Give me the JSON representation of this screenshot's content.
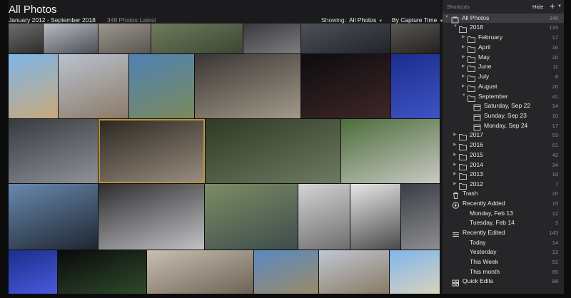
{
  "header": {
    "title": "All Photos",
    "date_range": "January 2012 - September 2018",
    "photo_count": "348 Photos Latest",
    "showing_label": "Showing:",
    "showing_value": "All Photos",
    "sort_value": "By Capture Time"
  },
  "sidebar": {
    "shortcuts_label": "Shortcuts",
    "hide_label": "Hide",
    "add_icon": "plus-icon",
    "rows": [
      {
        "name": "all-photos",
        "label": "All Photos",
        "count": "348",
        "icon": "photos-icon",
        "selected": true
      },
      {
        "name": "year-2018",
        "label": "2018",
        "count": "133",
        "icon": "folder-icon"
      },
      {
        "name": "month-february",
        "label": "February",
        "count": "17",
        "icon": "folder-icon"
      },
      {
        "name": "month-april",
        "label": "April",
        "count": "16",
        "icon": "folder-icon"
      },
      {
        "name": "month-may",
        "label": "May",
        "count": "20",
        "icon": "folder-icon"
      },
      {
        "name": "month-june",
        "label": "June",
        "count": "11",
        "icon": "folder-icon"
      },
      {
        "name": "month-july",
        "label": "July",
        "count": "8",
        "icon": "folder-icon"
      },
      {
        "name": "month-august",
        "label": "August",
        "count": "20",
        "icon": "folder-icon"
      },
      {
        "name": "month-september",
        "label": "September",
        "count": "41",
        "icon": "folder-icon"
      },
      {
        "name": "day-saturday-sep-22",
        "label": "Saturday, Sep 22",
        "count": "14",
        "icon": "day-icon"
      },
      {
        "name": "day-sunday-sep-23",
        "label": "Sunday, Sep 23",
        "count": "10",
        "icon": "day-icon"
      },
      {
        "name": "day-monday-sep-24",
        "label": "Monday, Sep 24",
        "count": "17",
        "icon": "day-icon"
      },
      {
        "name": "year-2017",
        "label": "2017",
        "count": "53",
        "icon": "folder-icon"
      },
      {
        "name": "year-2016",
        "label": "2016",
        "count": "61",
        "icon": "folder-icon"
      },
      {
        "name": "year-2015",
        "label": "2015",
        "count": "42",
        "icon": "folder-icon"
      },
      {
        "name": "year-2014",
        "label": "2014",
        "count": "34",
        "icon": "folder-icon"
      },
      {
        "name": "year-2013",
        "label": "2013",
        "count": "16",
        "icon": "folder-icon"
      },
      {
        "name": "year-2012",
        "label": "2012",
        "count": "7",
        "icon": "folder-icon"
      },
      {
        "name": "trash",
        "label": "Trash",
        "count": "20",
        "icon": "trash-icon"
      },
      {
        "name": "recently-added",
        "label": "Recently Added",
        "count": "15",
        "icon": "plus-circle-icon"
      },
      {
        "name": "added-monday-feb-13",
        "label": "Monday, Feb 13",
        "count": "12",
        "icon": ""
      },
      {
        "name": "added-tuesday-feb-14",
        "label": "Tuesday, Feb 14",
        "count": "3",
        "icon": ""
      },
      {
        "name": "recently-edited",
        "label": "Recently Edited",
        "count": "143",
        "icon": "sliders-icon"
      },
      {
        "name": "edited-today",
        "label": "Today",
        "count": "14",
        "icon": ""
      },
      {
        "name": "edited-yesterday",
        "label": "Yesterday",
        "count": "12",
        "icon": ""
      },
      {
        "name": "edited-this-week",
        "label": "This Week",
        "count": "52",
        "icon": ""
      },
      {
        "name": "edited-this-month",
        "label": "This month",
        "count": "65",
        "icon": ""
      },
      {
        "name": "quick-edits",
        "label": "Quick Edits",
        "count": "88",
        "icon": "grid-icon"
      }
    ]
  },
  "grid": {
    "photos": [
      {
        "name": "photo-street",
        "desc": "street-scene"
      },
      {
        "name": "photo-airport-window",
        "desc": "airport-window"
      },
      {
        "name": "photo-building",
        "desc": "building"
      },
      {
        "name": "photo-highway-interchange",
        "desc": "highway-interchange"
      },
      {
        "name": "photo-subway-interior",
        "desc": "subway-interior"
      },
      {
        "name": "photo-bridge",
        "desc": "bridge"
      },
      {
        "name": "photo-subway-car",
        "desc": "subway-car"
      },
      {
        "name": "photo-portrait-dark",
        "desc": "portrait"
      },
      {
        "name": "photo-truck",
        "desc": "truck"
      },
      {
        "name": "photo-temple-of-heaven",
        "desc": "temple-of-heaven"
      },
      {
        "name": "photo-woman-lake-view",
        "desc": "woman-lake-view"
      },
      {
        "name": "photo-train-interior",
        "desc": "train-interior"
      },
      {
        "name": "photo-car-night",
        "desc": "car-night"
      },
      {
        "name": "photo-blue-curtain",
        "desc": "blue-curtain"
      },
      {
        "name": "photo-airport-terminal",
        "desc": "airport-terminal"
      },
      {
        "name": "photo-sheltie-basket",
        "desc": "sheltie-basket"
      },
      {
        "name": "photo-forest-tree",
        "desc": "forest-tree"
      },
      {
        "name": "photo-mountain-valley",
        "desc": "mountain-valley"
      },
      {
        "name": "photo-kids-road",
        "desc": "kids-road"
      },
      {
        "name": "photo-airplane-wing",
        "desc": "airplane-wing"
      },
      {
        "name": "photo-plane-aisle",
        "desc": "plane-aisle"
      },
      {
        "name": "photo-highway-aerial",
        "desc": "highway-aerial"
      },
      {
        "name": "photo-architecture-bw",
        "desc": "architecture"
      },
      {
        "name": "photo-train-platform",
        "desc": "train-platform"
      },
      {
        "name": "photo-subway-station",
        "desc": "subway-station"
      },
      {
        "name": "photo-blue-curtain-2",
        "desc": "blue-curtain"
      },
      {
        "name": "photo-person-night",
        "desc": "person-night"
      },
      {
        "name": "photo-train-interior-2",
        "desc": "train-interior"
      },
      {
        "name": "photo-lake-mountains",
        "desc": "lake-mountains"
      },
      {
        "name": "photo-temple-2",
        "desc": "temple"
      },
      {
        "name": "photo-truck-2",
        "desc": "truck"
      }
    ]
  },
  "colors": {
    "sidebar_bg": "#262628",
    "selected_row": "#3d3d41",
    "selection_outline": "#b9953a",
    "grid_bg": "#0e0e10"
  }
}
